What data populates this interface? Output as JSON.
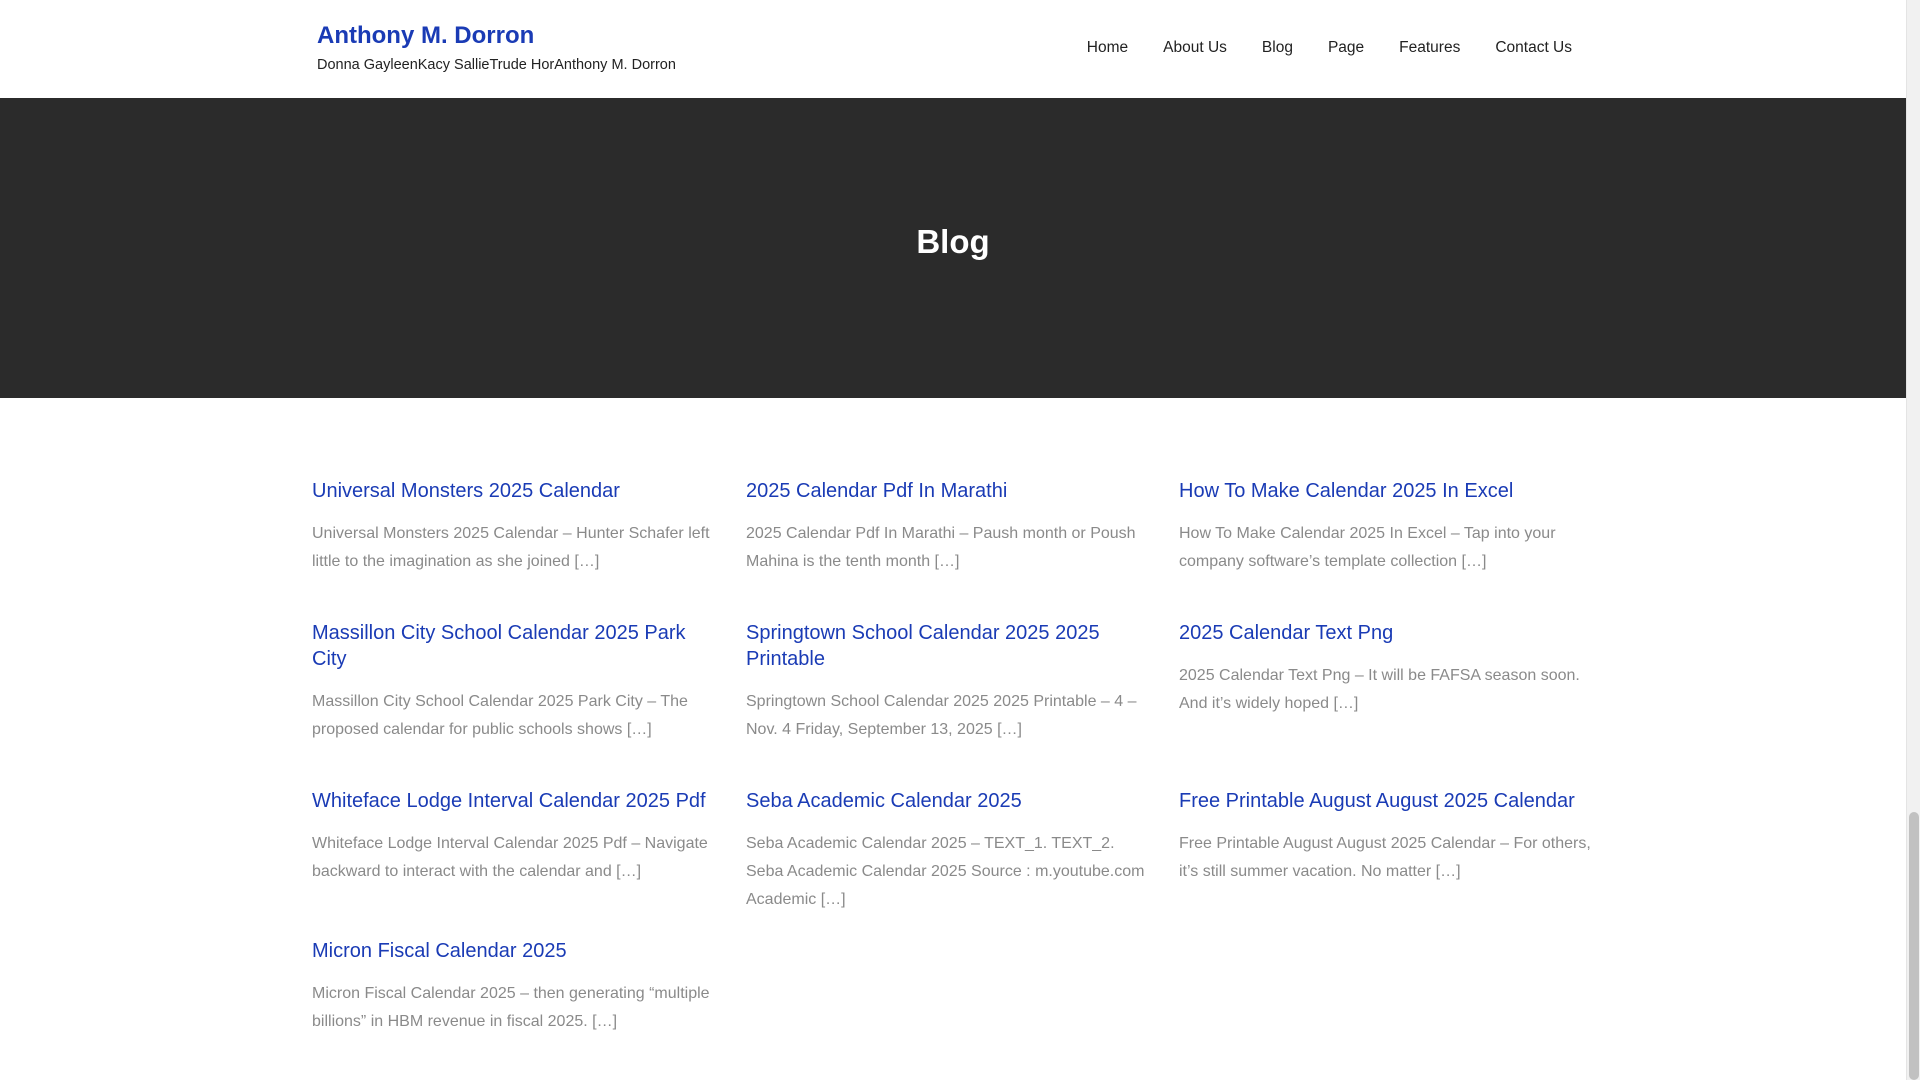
{
  "header": {
    "site_title": "Anthony M. Dorron",
    "site_description": "Donna GayleenKacy SallieTrude HorAnthony M. Dorron",
    "nav": [
      "Home",
      "About Us",
      "Blog",
      "Page",
      "Features",
      "Contact Us"
    ]
  },
  "hero": {
    "title": "Blog"
  },
  "posts": [
    {
      "title": "Universal Monsters 2025 Calendar",
      "excerpt": "Universal Monsters 2025 Calendar – Hunter Schafer left little to the imagination as she joined […]"
    },
    {
      "title": "2025 Calendar Pdf In Marathi",
      "excerpt": "2025 Calendar Pdf In Marathi – Paush month or Poush Mahina is the tenth month […]"
    },
    {
      "title": "How To Make Calendar 2025 In Excel",
      "excerpt": "How To Make Calendar 2025 In Excel – Tap into your company software’s template collection […]"
    },
    {
      "title": "Massillon City School Calendar 2025 Park City",
      "excerpt": "Massillon City School Calendar 2025 Park City – The proposed calendar for public schools shows […]"
    },
    {
      "title": "Springtown School Calendar 2025 2025 Printable",
      "excerpt": "Springtown School Calendar 2025 2025 Printable – 4 – Nov. 4 Friday, September 13, 2025 […]"
    },
    {
      "title": "2025 Calendar Text Png",
      "excerpt": "2025 Calendar Text Png – It will be FAFSA season soon. And it’s widely hoped […]"
    },
    {
      "title": "Whiteface Lodge Interval Calendar 2025 Pdf",
      "excerpt": "Whiteface Lodge Interval Calendar 2025 Pdf – Navigate backward to interact with the calendar and […]"
    },
    {
      "title": "Seba Academic Calendar 2025",
      "excerpt": "Seba Academic Calendar 2025 – TEXT_1. TEXT_2. Seba Academic Calendar 2025 Source : m.youtube.com Academic […]"
    },
    {
      "title": "Free Printable August August 2025 Calendar",
      "excerpt": "Free Printable August August 2025 Calendar – For others, it’s still summer vacation. No matter […]"
    },
    {
      "title": "Micron Fiscal Calendar 2025",
      "excerpt": "Micron Fiscal Calendar 2025 – then generating “multiple billions” in HBM revenue in fiscal 2025. […]"
    }
  ],
  "colors": {
    "link": "#1a3bb5",
    "hero_bg": "#2b2b2b",
    "excerpt": "#8a8a8a"
  }
}
